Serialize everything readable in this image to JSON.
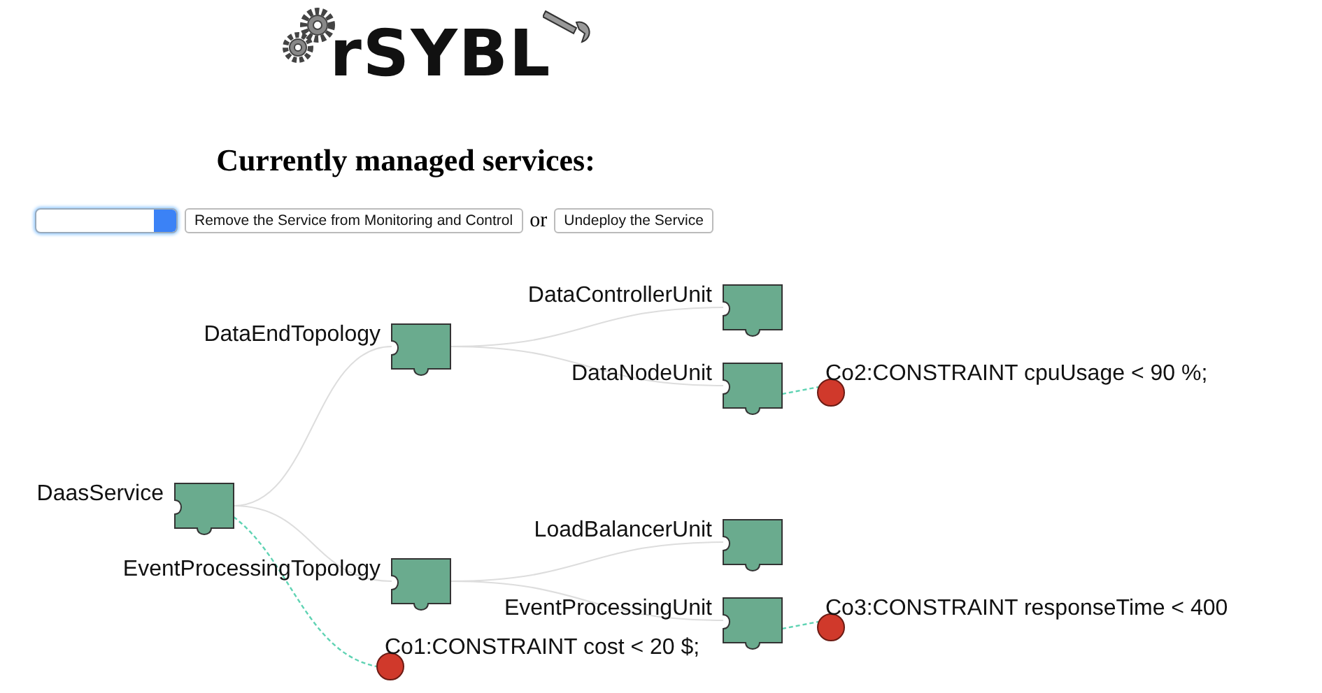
{
  "logo": {
    "text": "rSYBL"
  },
  "title": "Currently managed services:",
  "controls": {
    "remove_button": "Remove the Service from Monitoring and Control",
    "separator": "or",
    "undeploy_button": "Undeploy the Service"
  },
  "service_tree": {
    "name": "DaasService",
    "constraints": [
      "Co1:CONSTRAINT cost < 20 $;"
    ],
    "children": [
      {
        "name": "DataEndTopology",
        "children": [
          {
            "name": "DataControllerUnit"
          },
          {
            "name": "DataNodeUnit",
            "constraints": [
              "Co2:CONSTRAINT cpuUsage < 90 %;"
            ]
          }
        ]
      },
      {
        "name": "EventProcessingTopology",
        "children": [
          {
            "name": "LoadBalancerUnit"
          },
          {
            "name": "EventProcessingUnit",
            "constraints": [
              "Co3:CONSTRAINT responseTime < 400"
            ]
          }
        ]
      }
    ]
  }
}
